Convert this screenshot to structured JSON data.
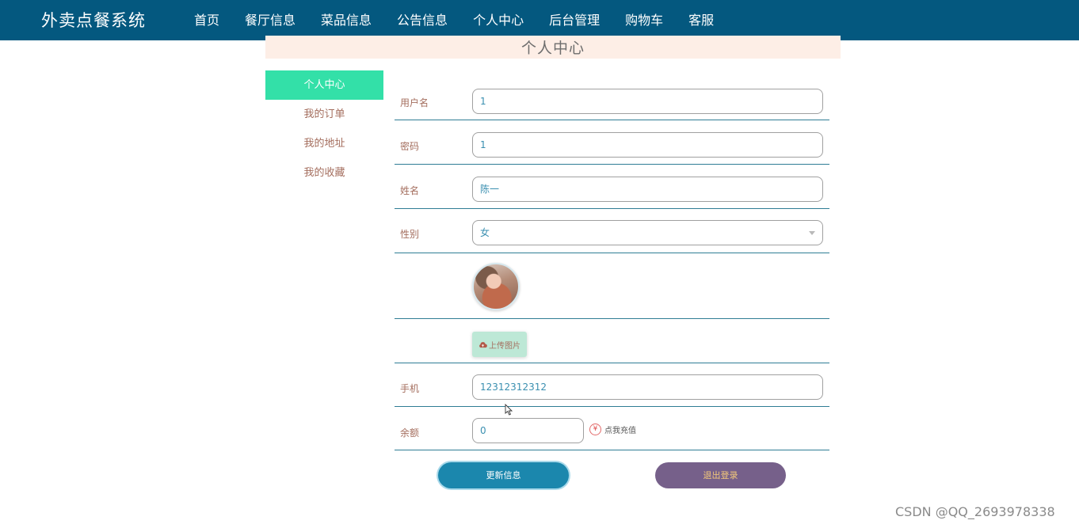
{
  "nav": {
    "brand": "外卖点餐系统",
    "items": [
      {
        "label": "首页"
      },
      {
        "label": "餐厅信息"
      },
      {
        "label": "菜品信息"
      },
      {
        "label": "公告信息"
      },
      {
        "label": "个人中心"
      },
      {
        "label": "后台管理"
      },
      {
        "label": "购物车"
      },
      {
        "label": "客服"
      }
    ],
    "active": "个人中心"
  },
  "page": {
    "title": "个人中心"
  },
  "sidebar": {
    "items": [
      {
        "label": "个人中心"
      },
      {
        "label": "我的订单"
      },
      {
        "label": "我的地址"
      },
      {
        "label": "我的收藏"
      }
    ]
  },
  "form": {
    "username": {
      "label": "用户名",
      "value": "1"
    },
    "password": {
      "label": "密码",
      "value": "1"
    },
    "name": {
      "label": "姓名",
      "value": "陈一"
    },
    "gender": {
      "label": "性别",
      "value": "女"
    },
    "avatar": {
      "icon": "avatar-photo"
    },
    "upload": {
      "label": "上传图片",
      "icon": "cloud-upload-icon"
    },
    "phone": {
      "label": "手机",
      "value": "12312312312"
    },
    "balance": {
      "label": "余额",
      "value": "0",
      "recharge_label": "点我充值",
      "recharge_icon_text": "¥"
    }
  },
  "actions": {
    "update_label": "更新信息",
    "logout_label": "退出登录"
  },
  "colors": {
    "nav_bg": "#04587f",
    "side_active": "#33e0a8",
    "update_btn": "#1b87ad",
    "logout_btn": "#76608a",
    "banner_bg": "#fdeee6"
  },
  "watermark": "CSDN @QQ_2693978338"
}
